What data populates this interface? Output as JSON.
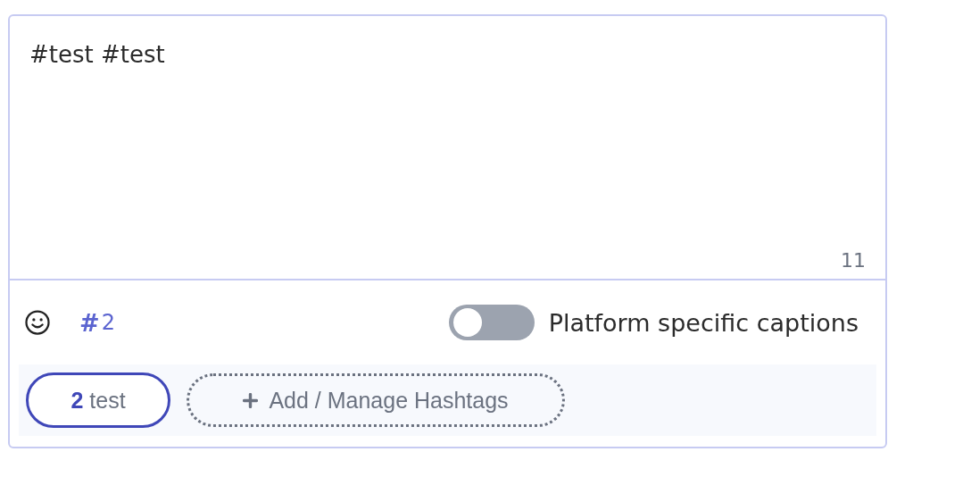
{
  "editor": {
    "value": "#test #test",
    "char_count": "11"
  },
  "toolbar": {
    "hashtag_symbol": "#",
    "hashtag_count": "2",
    "toggle": {
      "label": "Platform specific captions",
      "on": false
    }
  },
  "hashtags": [
    {
      "count": "2",
      "tag": "test",
      "selected": true
    }
  ],
  "add_button": {
    "label": "Add / Manage Hashtags"
  }
}
